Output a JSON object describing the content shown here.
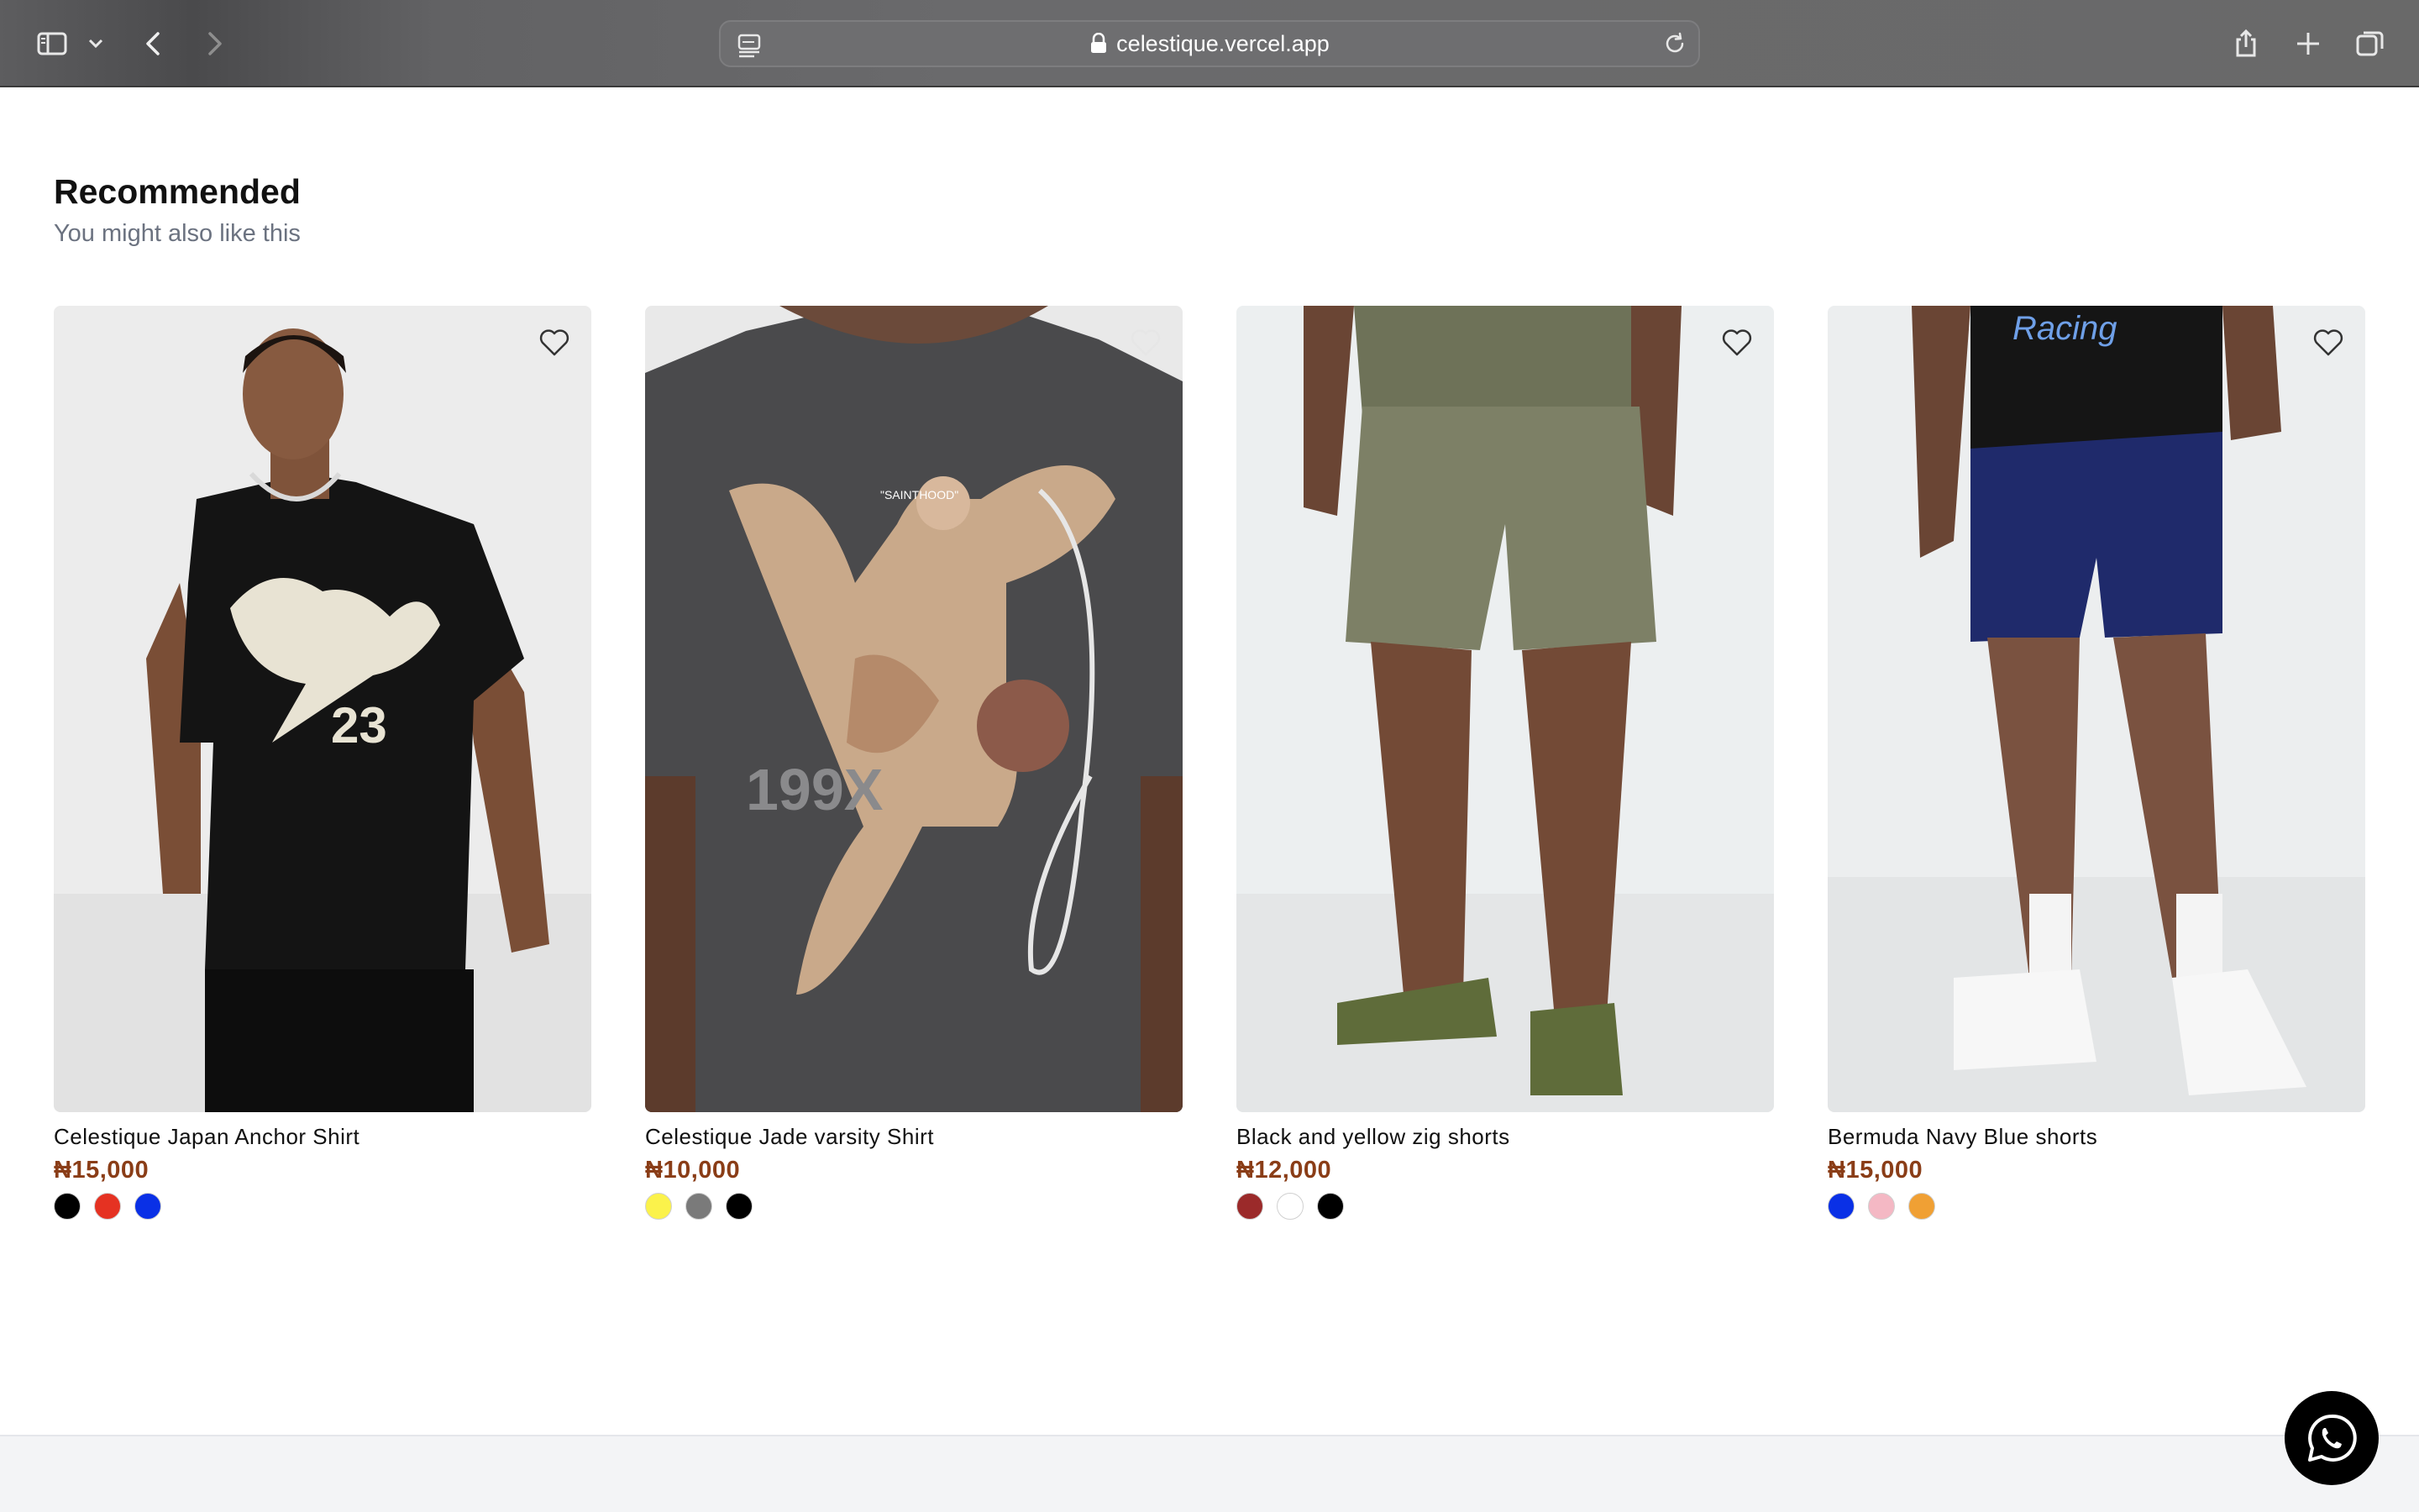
{
  "browser": {
    "url_host": "celestique.vercel.app",
    "icons": [
      "sidebar-icon",
      "chevron-down-icon",
      "back-icon",
      "forward-icon",
      "reader-icon",
      "lock-icon",
      "reload-icon",
      "share-icon",
      "new-tab-icon",
      "tabs-overview-icon"
    ]
  },
  "section": {
    "title": "Recommended",
    "subtitle": "You might also like this"
  },
  "products": [
    {
      "name": "Celestique Japan Anchor Shirt",
      "price": "₦15,000",
      "colors": [
        "#000000",
        "#e53222",
        "#0a30e6"
      ]
    },
    {
      "name": "Celestique Jade varsity Shirt",
      "price": "₦10,000",
      "colors": [
        "#fbf24b",
        "#7a7a7a",
        "#000000"
      ]
    },
    {
      "name": "Black and yellow zig shorts",
      "price": "₦12,000",
      "colors": [
        "#9b2a2a",
        "#ffffff",
        "#000000"
      ]
    },
    {
      "name": "Bermuda Navy Blue shorts",
      "price": "₦15,000",
      "colors": [
        "#0a30e6",
        "#f4b8c4",
        "#f0a034"
      ]
    }
  ],
  "colors": {
    "price": "#8a3d17",
    "subtitle": "#6b7280",
    "whatsapp_bg": "#000000"
  }
}
